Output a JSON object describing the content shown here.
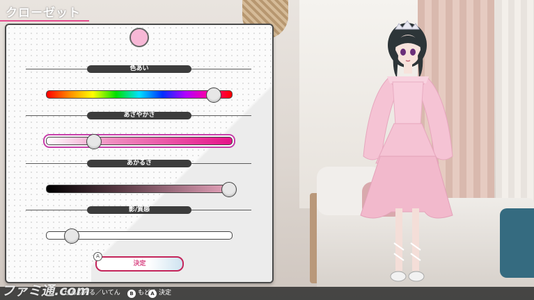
{
  "screen": {
    "title": "クローゼット",
    "watermark": "ファミ通.com"
  },
  "preview_color": "#f7b8d6",
  "sections": [
    {
      "label": "色あい",
      "value": 0.9
    },
    {
      "label": "あざやかさ",
      "value": 0.25
    },
    {
      "label": "あかるさ",
      "value": 0.98
    },
    {
      "label": "影/質感",
      "value": 0.13
    }
  ],
  "confirm": {
    "label": "決定",
    "badge": "A"
  },
  "hints": [
    {
      "button": "",
      "label": "ぜんぶみる／いてん"
    },
    {
      "button": "B",
      "label": "もどる"
    },
    {
      "button": "A",
      "label": "決定"
    }
  ],
  "colors": {
    "accent": "#e54d8e",
    "selected_outline": "#c63ea9",
    "dress": "#f5c3d4"
  }
}
